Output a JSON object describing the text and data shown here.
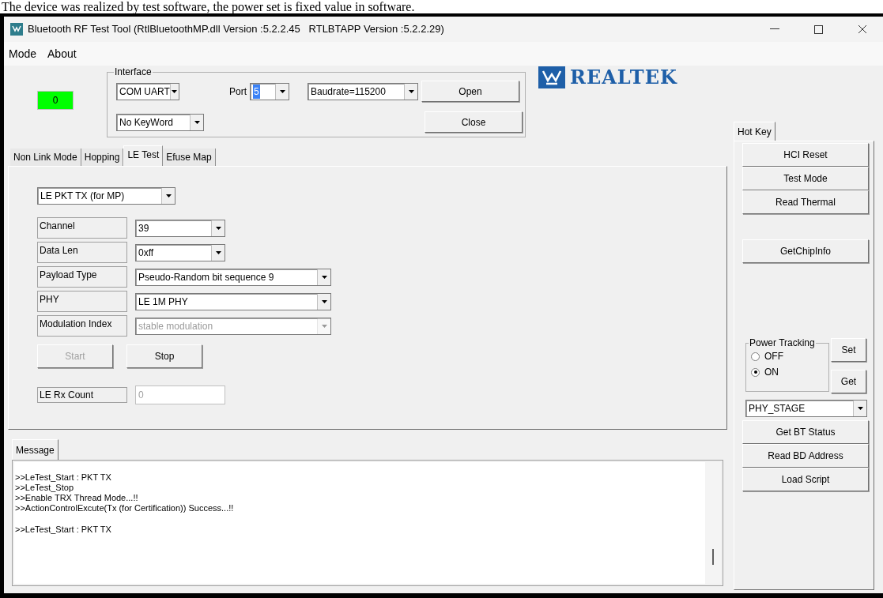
{
  "caption": "The device was realized by test software, the power set is fixed value in software.",
  "window": {
    "title": "Bluetooth RF Test Tool (RtlBluetoothMP.dll Version :5.2.2.45   RTLBTAPP Version :5.2.2.29)"
  },
  "menu": [
    "Mode",
    "About"
  ],
  "status_indicator": {
    "value": "0",
    "color": "#00ff00"
  },
  "interface": {
    "title": "Interface",
    "connection": "COM UART",
    "port_label": "Port",
    "port": "5",
    "port_highlighted": true,
    "baudrate": "Baudrate=115200",
    "keyword": "No KeyWord",
    "open": "Open",
    "close": "Close"
  },
  "logo": {
    "text": "REALTEK"
  },
  "tabs": [
    {
      "label": "Non Link Mode",
      "selected": false
    },
    {
      "label": "Hopping",
      "selected": false
    },
    {
      "label": "LE Test",
      "selected": true
    },
    {
      "label": "Efuse Map",
      "selected": false
    }
  ],
  "le_test": {
    "mode": "LE PKT TX (for MP)",
    "fields": [
      {
        "label": "Channel",
        "value": "39",
        "wide": false,
        "disabled": false
      },
      {
        "label": "Data Len",
        "value": "0xff",
        "wide": false,
        "disabled": false
      },
      {
        "label": "Payload Type",
        "value": "Pseudo-Random bit sequence 9",
        "wide": true,
        "disabled": false
      },
      {
        "label": "PHY",
        "value": "LE 1M PHY",
        "wide": true,
        "disabled": false
      },
      {
        "label": "Modulation Index",
        "value": "stable modulation",
        "wide": true,
        "disabled": true
      }
    ],
    "buttons": [
      {
        "label": "Start",
        "disabled": true
      },
      {
        "label": "Stop",
        "disabled": false
      }
    ],
    "rx_count": {
      "label": "LE Rx Count",
      "value": "0"
    }
  },
  "message": {
    "tab": "Message",
    "blocks": [
      [
        ">>LeTest_Start : PKT TX",
        ">>LeTest_Stop",
        ">>Enable TRX Thread Mode...!!",
        ">>ActionControlExcute(Tx (for Certification)) Success...!!"
      ],
      [
        ">>LeTest_Start : PKT TX"
      ]
    ]
  },
  "hotkey": {
    "tab": "Hot Key",
    "button_groups": [
      [
        "HCI Reset",
        "Test Mode",
        "Read Thermal"
      ],
      [
        "GetChipInfo"
      ]
    ],
    "power_tracking": {
      "title": "Power Tracking",
      "options": [
        {
          "label": "OFF",
          "selected": false
        },
        {
          "label": "ON",
          "selected": true
        }
      ],
      "set": "Set",
      "get": "Get"
    },
    "stage": "PHY_STAGE",
    "lower_buttons": [
      "Get BT Status",
      "Read BD Address",
      "Load Script"
    ]
  }
}
